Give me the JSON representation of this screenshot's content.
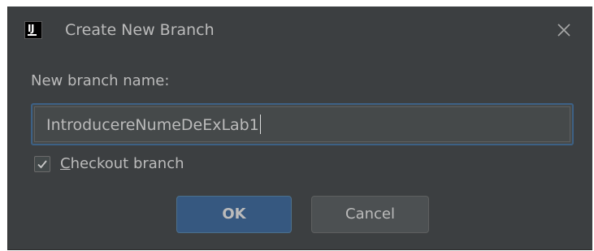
{
  "dialog": {
    "title": "Create New Branch",
    "app_icon": "intellij-idea-icon",
    "close_icon": "close-icon"
  },
  "form": {
    "branch_name_label": "New branch name:",
    "branch_name_value": "IntroducereNumeDeExLab1",
    "checkout": {
      "checked": true,
      "mnemonic": "C",
      "label_rest": "heckout branch"
    }
  },
  "buttons": {
    "ok_label": "OK",
    "cancel_label": "Cancel"
  },
  "colors": {
    "background": "#3c3f41",
    "text": "#bbbbbb",
    "accent": "#365880",
    "focus_border": "#3d6185"
  }
}
